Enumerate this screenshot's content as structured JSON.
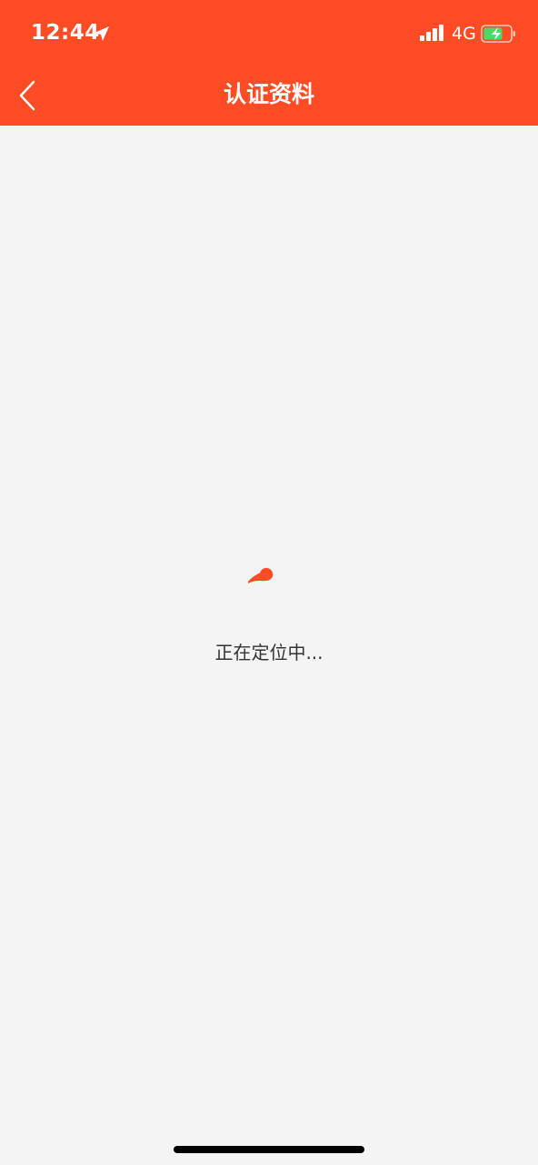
{
  "status_bar": {
    "time": "12:44",
    "network": "4G"
  },
  "nav": {
    "title": "认证资料"
  },
  "content": {
    "loading_text": "正在定位中..."
  },
  "colors": {
    "accent": "#ff4c25",
    "background": "#f4f4f4",
    "text": "#333333",
    "battery_charge": "#4cd964"
  },
  "icons": {
    "back": "chevron-left-icon",
    "location": "location-arrow-icon",
    "signal": "signal-bars-icon",
    "battery": "battery-charging-icon",
    "spinner": "loading-spinner-icon"
  }
}
